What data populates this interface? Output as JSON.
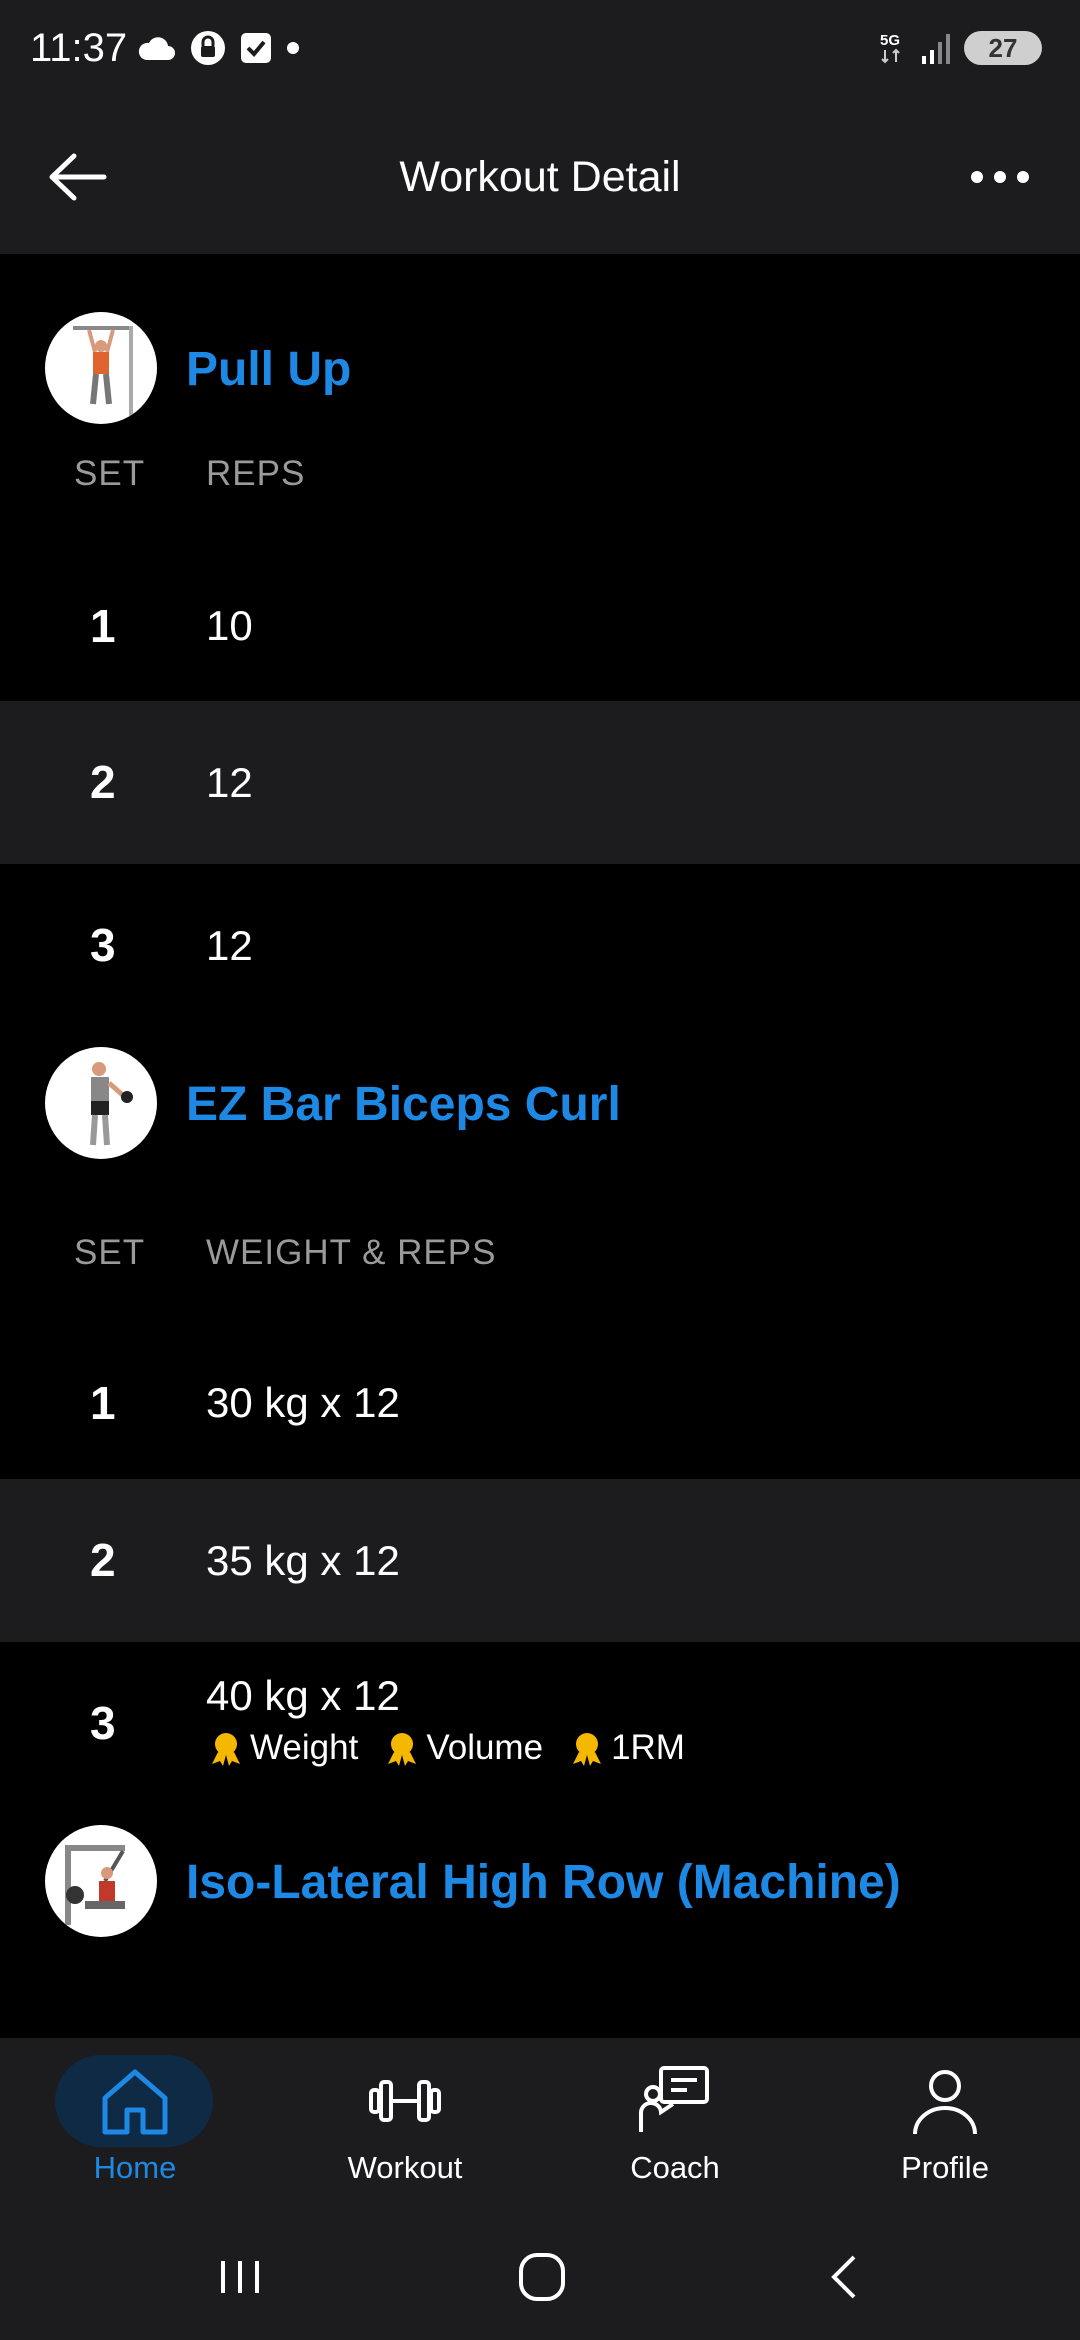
{
  "status_bar": {
    "time": "11:37",
    "network": "5G",
    "battery": "27"
  },
  "app_bar": {
    "title": "Workout Detail"
  },
  "exercises": [
    {
      "name": "Pull Up",
      "column_set": "SET",
      "column_value": "REPS",
      "sets": [
        {
          "num": "1",
          "value": "10"
        },
        {
          "num": "2",
          "value": "12"
        },
        {
          "num": "3",
          "value": "12"
        }
      ]
    },
    {
      "name": "EZ Bar Biceps Curl",
      "column_set": "SET",
      "column_value": "WEIGHT & REPS",
      "sets": [
        {
          "num": "1",
          "value": "30 kg x 12"
        },
        {
          "num": "2",
          "value": "35 kg x 12"
        },
        {
          "num": "3",
          "value": "40 kg x 12",
          "records": [
            "Weight",
            "Volume",
            "1RM"
          ]
        }
      ]
    },
    {
      "name": "Iso-Lateral High Row (Machine)"
    }
  ],
  "bottom_nav": {
    "items": [
      {
        "label": "Home",
        "icon": "home-icon",
        "active": true
      },
      {
        "label": "Workout",
        "icon": "dumbbell-icon",
        "active": false
      },
      {
        "label": "Coach",
        "icon": "coach-icon",
        "active": false
      },
      {
        "label": "Profile",
        "icon": "profile-icon",
        "active": false
      }
    ]
  },
  "colors": {
    "accent": "#1e88e5",
    "background": "#000000",
    "surface": "#1c1c1e",
    "muted_text": "#9a9a9a",
    "medal": "#f5b800"
  }
}
